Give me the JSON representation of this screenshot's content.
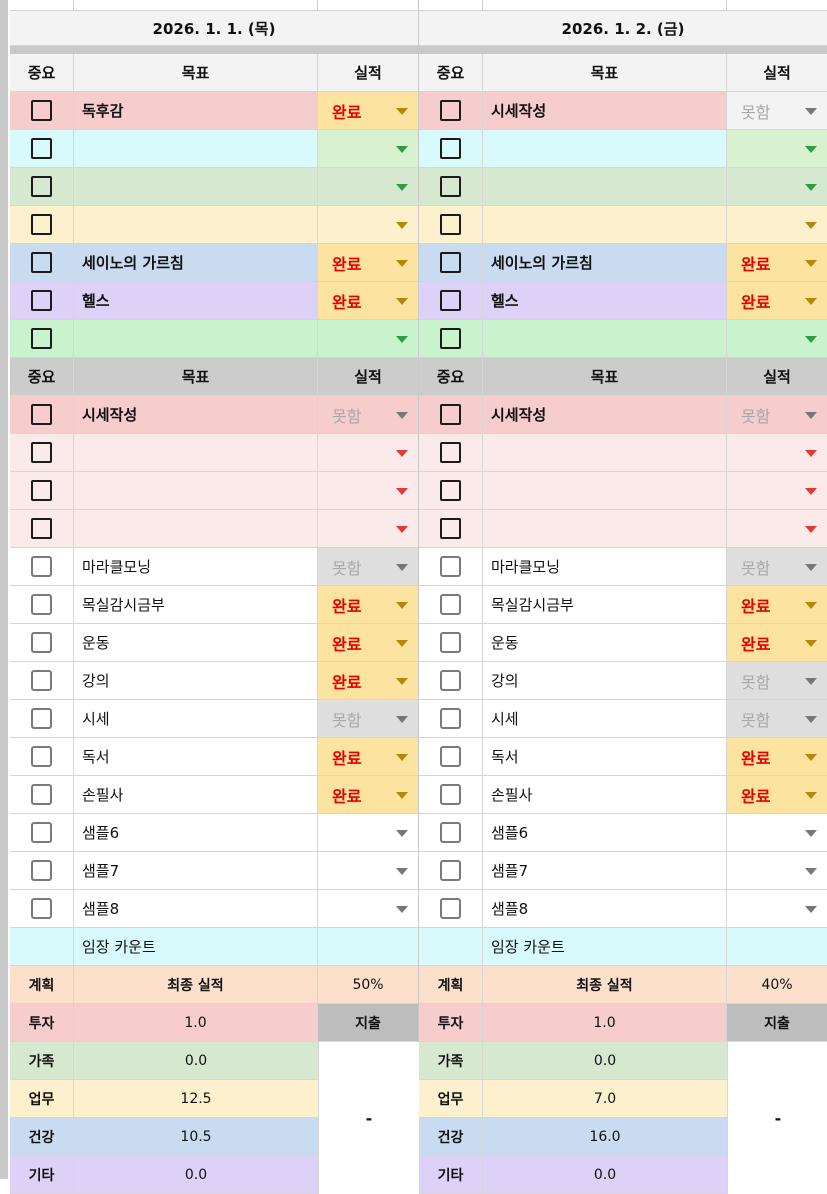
{
  "columns": [
    {
      "date": "2026. 1. 1. (목)",
      "header1": {
        "imp": "중요",
        "goal": "목표",
        "result": "실적"
      },
      "top": [
        {
          "goal": "독후감",
          "result": "완료",
          "status": "done",
          "bg": "#f6cccc",
          "resbg": "#fde3a0",
          "arrow": "orange"
        },
        {
          "goal": "",
          "result": "",
          "status": "empty",
          "bg": "#d8fafd",
          "resbg": "#d8f2d0",
          "arrow": "green"
        },
        {
          "goal": "",
          "result": "",
          "status": "empty",
          "bg": "#d7e8d1",
          "resbg": "#d7e8d1",
          "arrow": "green"
        },
        {
          "goal": "",
          "result": "",
          "status": "empty",
          "bg": "#fdf0cc",
          "resbg": "#fdf0cc",
          "arrow": "orange"
        },
        {
          "goal": "세이노의 가르침",
          "result": "완료",
          "status": "done",
          "bg": "#c9dbf1",
          "resbg": "#fde3a0",
          "arrow": "orange"
        },
        {
          "goal": "헬스",
          "result": "완료",
          "status": "done",
          "bg": "#ddd1f7",
          "resbg": "#fde3a0",
          "arrow": "orange"
        },
        {
          "goal": "",
          "result": "",
          "status": "empty",
          "bg": "#c9f3cd",
          "resbg": "#c9f3cd",
          "arrow": "green"
        }
      ],
      "header2": {
        "imp": "중요",
        "goal": "목표",
        "result": "실적"
      },
      "mid": [
        {
          "goal": "시세작성",
          "result": "못함",
          "status": "miss",
          "bg": "#f6cccc",
          "resbg": "#f6cccc",
          "arrow": "gray"
        },
        {
          "goal": "",
          "result": "",
          "status": "empty",
          "bg": "#fbeaea",
          "resbg": "#fbeaea",
          "arrow": "red"
        },
        {
          "goal": "",
          "result": "",
          "status": "empty",
          "bg": "#fbeaea",
          "resbg": "#fbeaea",
          "arrow": "red"
        },
        {
          "goal": "",
          "result": "",
          "status": "empty",
          "bg": "#fbeaea",
          "resbg": "#fbeaea",
          "arrow": "red"
        }
      ],
      "habits": [
        {
          "goal": "마라클모닝",
          "result": "못함",
          "status": "miss"
        },
        {
          "goal": "목실감시금부",
          "result": "완료",
          "status": "done"
        },
        {
          "goal": "운동",
          "result": "완료",
          "status": "done"
        },
        {
          "goal": "강의",
          "result": "완료",
          "status": "done"
        },
        {
          "goal": "시세",
          "result": "못함",
          "status": "miss"
        },
        {
          "goal": "독서",
          "result": "완료",
          "status": "done"
        },
        {
          "goal": "손필사",
          "result": "완료",
          "status": "done"
        },
        {
          "goal": "샘플6",
          "result": "",
          "status": "empty"
        },
        {
          "goal": "샘플7",
          "result": "",
          "status": "empty"
        },
        {
          "goal": "샘플8",
          "result": "",
          "status": "empty"
        }
      ],
      "count_label": "임장 카운트",
      "plan_label": "계획",
      "final_label": "최종 실적",
      "final_pct": "50%",
      "spend_label": "지출",
      "spend_value": "-",
      "cats": [
        {
          "label": "투자",
          "value": "1.0",
          "bg": "#f6cccc"
        },
        {
          "label": "가족",
          "value": "0.0",
          "bg": "#d7e8d1"
        },
        {
          "label": "업무",
          "value": "12.5",
          "bg": "#fdf0cc"
        },
        {
          "label": "건강",
          "value": "10.5",
          "bg": "#c9dbf1"
        },
        {
          "label": "기타",
          "value": "0.0",
          "bg": "#ddd1f7"
        }
      ]
    },
    {
      "date": "2026. 1. 2. (금)",
      "header1": {
        "imp": "중요",
        "goal": "목표",
        "result": "실적"
      },
      "top": [
        {
          "goal": "시세작성",
          "result": "못함",
          "status": "miss",
          "bg": "#f6cccc",
          "resbg": "#f3f3f3",
          "arrow": "gray"
        },
        {
          "goal": "",
          "result": "",
          "status": "empty",
          "bg": "#d8fafd",
          "resbg": "#d8f2d0",
          "arrow": "green"
        },
        {
          "goal": "",
          "result": "",
          "status": "empty",
          "bg": "#d7e8d1",
          "resbg": "#d7e8d1",
          "arrow": "green"
        },
        {
          "goal": "",
          "result": "",
          "status": "empty",
          "bg": "#fdf0cc",
          "resbg": "#fdf0cc",
          "arrow": "orange"
        },
        {
          "goal": "세이노의 가르침",
          "result": "완료",
          "status": "done",
          "bg": "#c9dbf1",
          "resbg": "#fde3a0",
          "arrow": "orange"
        },
        {
          "goal": "헬스",
          "result": "완료",
          "status": "done",
          "bg": "#ddd1f7",
          "resbg": "#fde3a0",
          "arrow": "orange"
        },
        {
          "goal": "",
          "result": "",
          "status": "empty",
          "bg": "#c9f3cd",
          "resbg": "#c9f3cd",
          "arrow": "green"
        }
      ],
      "header2": {
        "imp": "중요",
        "goal": "목표",
        "result": "실적"
      },
      "mid": [
        {
          "goal": "시세작성",
          "result": "못함",
          "status": "miss",
          "bg": "#f6cccc",
          "resbg": "#f6cccc",
          "arrow": "gray"
        },
        {
          "goal": "",
          "result": "",
          "status": "empty",
          "bg": "#fbeaea",
          "resbg": "#fbeaea",
          "arrow": "red"
        },
        {
          "goal": "",
          "result": "",
          "status": "empty",
          "bg": "#fbeaea",
          "resbg": "#fbeaea",
          "arrow": "red"
        },
        {
          "goal": "",
          "result": "",
          "status": "empty",
          "bg": "#fbeaea",
          "resbg": "#fbeaea",
          "arrow": "red"
        }
      ],
      "habits": [
        {
          "goal": "마라클모닝",
          "result": "못함",
          "status": "miss"
        },
        {
          "goal": "목실감시금부",
          "result": "완료",
          "status": "done"
        },
        {
          "goal": "운동",
          "result": "완료",
          "status": "done"
        },
        {
          "goal": "강의",
          "result": "못함",
          "status": "miss"
        },
        {
          "goal": "시세",
          "result": "못함",
          "status": "miss"
        },
        {
          "goal": "독서",
          "result": "완료",
          "status": "done"
        },
        {
          "goal": "손필사",
          "result": "완료",
          "status": "done"
        },
        {
          "goal": "샘플6",
          "result": "",
          "status": "empty"
        },
        {
          "goal": "샘플7",
          "result": "",
          "status": "empty"
        },
        {
          "goal": "샘플8",
          "result": "",
          "status": "empty"
        }
      ],
      "count_label": "임장 카운트",
      "plan_label": "계획",
      "final_label": "최종 실적",
      "final_pct": "40%",
      "spend_label": "지출",
      "spend_value": "-",
      "cats": [
        {
          "label": "투자",
          "value": "1.0",
          "bg": "#f6cccc"
        },
        {
          "label": "가족",
          "value": "0.0",
          "bg": "#d7e8d1"
        },
        {
          "label": "업무",
          "value": "7.0",
          "bg": "#fdf0cc"
        },
        {
          "label": "건강",
          "value": "16.0",
          "bg": "#c9dbf1"
        },
        {
          "label": "기타",
          "value": "0.0",
          "bg": "#ddd1f7"
        }
      ]
    }
  ],
  "colors": {
    "header_bg": "#f3f3f3",
    "header2_bg": "#cccccc",
    "done_bg": "#fde3a0",
    "miss_bg": "#dedede",
    "done_text": "#e60000",
    "miss_text": "#a8a8a8",
    "count_bg": "#d8fafd",
    "plan_bg": "#fce0cc",
    "spend_bg": "#bdbdbd"
  },
  "icons": [
    "checkbox-icon",
    "dropdown-arrow-icon"
  ]
}
